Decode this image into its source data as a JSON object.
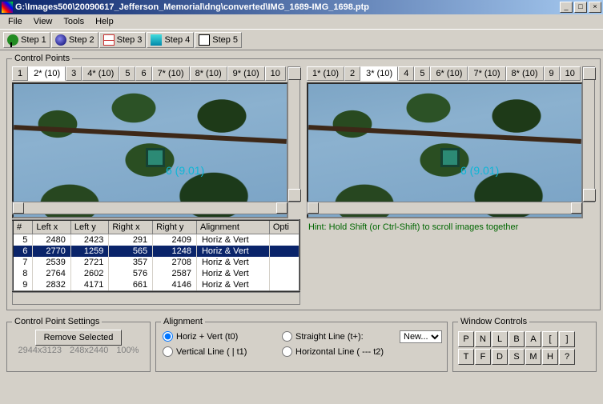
{
  "window": {
    "title": "G:\\Images500\\20090617_Jefferson_Memorial\\dng\\converted\\IMG_1689-IMG_1698.ptp",
    "buttons": {
      "min": "_",
      "max": "□",
      "close": "×"
    }
  },
  "menu": {
    "file": "File",
    "view": "View",
    "tools": "Tools",
    "help": "Help"
  },
  "steps": {
    "s1": "Step 1",
    "s2": "Step 2",
    "s3": "Step 3",
    "s4": "Step 4",
    "s5": "Step 5"
  },
  "cp": {
    "legend": "Control Points",
    "left_tabs": [
      "1",
      "2* (10)",
      "3",
      "4* (10)",
      "5",
      "6",
      "7* (10)",
      "8* (10)",
      "9* (10)",
      "10"
    ],
    "right_tabs": [
      "1* (10)",
      "2",
      "3* (10)",
      "4",
      "5",
      "6* (10)",
      "7* (10)",
      "8* (10)",
      "9",
      "10"
    ],
    "left_active": 1,
    "right_active": 2,
    "marker_label": "6 (9.01)",
    "hint": "Hint: Hold Shift (or Ctrl-Shift) to scroll images together",
    "headers": {
      "num": "#",
      "lx": "Left x",
      "ly": "Left y",
      "rx": "Right x",
      "ry": "Right y",
      "al": "Alignment",
      "opt": "Opti"
    },
    "rows": [
      {
        "n": "5",
        "lx": "2480",
        "ly": "2423",
        "rx": "291",
        "ry": "2409",
        "al": "Horiz & Vert"
      },
      {
        "n": "6",
        "lx": "2770",
        "ly": "1259",
        "rx": "565",
        "ry": "1248",
        "al": "Horiz & Vert",
        "sel": true
      },
      {
        "n": "7",
        "lx": "2539",
        "ly": "2721",
        "rx": "357",
        "ry": "2708",
        "al": "Horiz & Vert"
      },
      {
        "n": "8",
        "lx": "2764",
        "ly": "2602",
        "rx": "576",
        "ry": "2587",
        "al": "Horiz & Vert"
      },
      {
        "n": "9",
        "lx": "2832",
        "ly": "4171",
        "rx": "661",
        "ry": "4146",
        "al": "Horiz & Vert"
      }
    ]
  },
  "cps": {
    "legend": "Control Point Settings",
    "remove": "Remove Selected",
    "dims1": "2944x3123",
    "dims2": "248x2440",
    "zoom": "100%"
  },
  "align": {
    "legend": "Alignment",
    "hv": "Horiz + Vert (t0)",
    "sl": "Straight Line (t+):",
    "vl": "Vertical Line ( | t1)",
    "hl": "Horizontal Line ( --- t2)",
    "sel": "New..."
  },
  "wc": {
    "legend": "Window Controls",
    "row1": [
      "P",
      "N",
      "L",
      "B",
      "A",
      "[",
      "]"
    ],
    "row2": [
      "T",
      "F",
      "D",
      "S",
      "M",
      "H",
      "?"
    ]
  }
}
